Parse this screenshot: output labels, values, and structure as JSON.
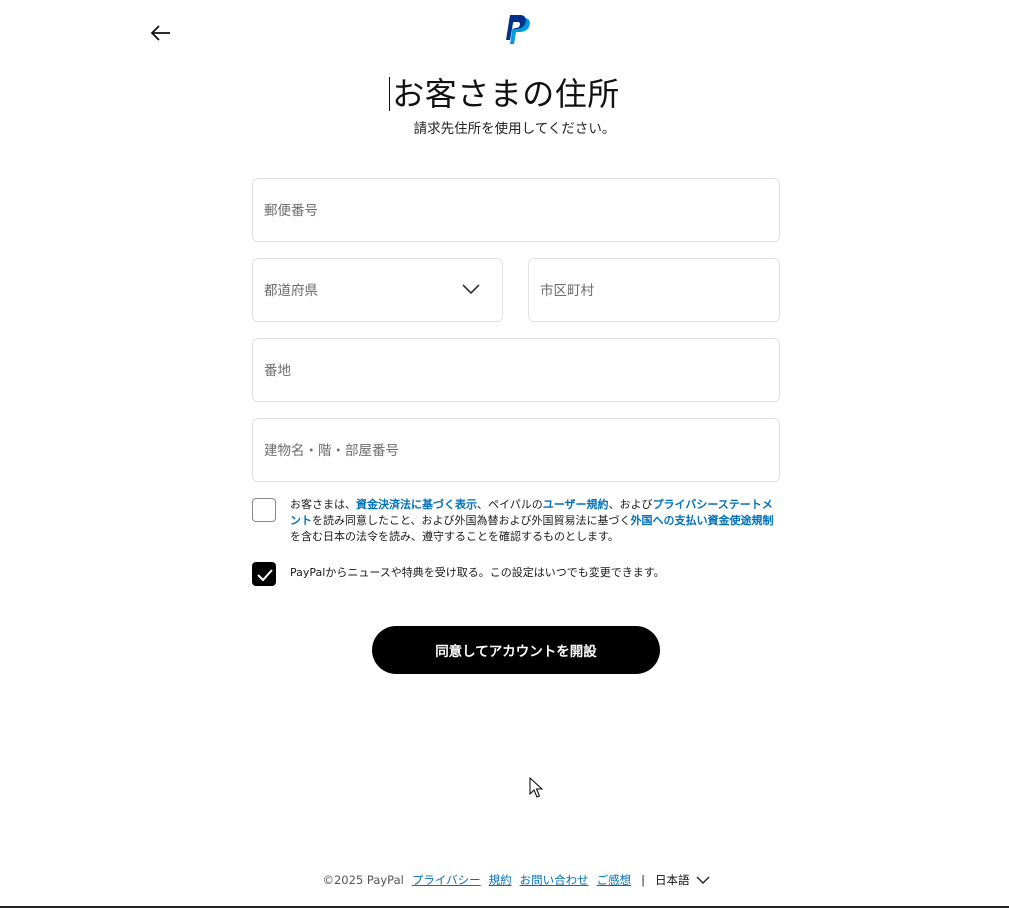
{
  "header": {
    "back_icon": "arrow-left-icon",
    "logo_icon": "paypal-logo-icon",
    "title": "お客さまの住所",
    "subtitle": "請求先住所を使用してください。"
  },
  "form": {
    "postal_code": {
      "placeholder": "郵便番号",
      "value": ""
    },
    "prefecture": {
      "placeholder": "都道府県",
      "value": ""
    },
    "city": {
      "placeholder": "市区町村",
      "value": ""
    },
    "street": {
      "placeholder": "番地",
      "value": ""
    },
    "building": {
      "placeholder": "建物名・階・部屋番号",
      "value": ""
    }
  },
  "consent": {
    "checked": false,
    "t1": "お客さまは、",
    "link1": "資金決済法に基づく表示",
    "t2": "、ペイパルの",
    "link2": "ユーザー規約",
    "t3": "、および",
    "link3": "プライバシーステートメント",
    "t4": "を読み同意したこと、および外国為替および外国貿易法に基づく",
    "link4": "外国への支払い資金使途規制",
    "t5": "を含む日本の法令を読み、遵守することを確認するものとします。"
  },
  "newsletter": {
    "checked": true,
    "label": "PayPalからニュースや特典を受け取る。この設定はいつでも変更できます。"
  },
  "submit_label": "同意してアカウントを開設",
  "footer": {
    "copyright": "©2025 PayPal",
    "privacy": "プライバシー",
    "terms": "規約",
    "contact": "お問い合わせ",
    "feedback": "ご感想",
    "separator": "|",
    "language": "日本語"
  },
  "colors": {
    "link": "#0070ba",
    "paypal_dark": "#003087",
    "paypal_light": "#009cde",
    "button": "#000000"
  }
}
